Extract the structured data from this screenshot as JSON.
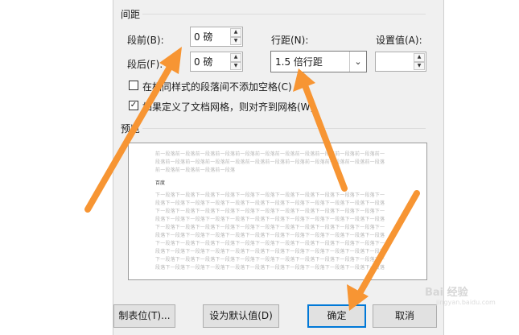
{
  "section": {
    "spacing_title": "间距",
    "preview_title": "预览"
  },
  "spacing": {
    "before_label": "段前(B):",
    "before_value": "0 磅",
    "after_label": "段后(F):",
    "after_value": "0 磅",
    "line_label": "行距(N):",
    "line_value": "1.5 倍行距",
    "setting_label": "设置值(A):",
    "setting_value": ""
  },
  "checkboxes": {
    "same_style_label": "在相同样式的段落间不添加空格(C)",
    "same_style_checked": false,
    "grid_label": "如果定义了文档网格，则对齐到网格(W)",
    "grid_checked": true
  },
  "preview": {
    "prev_lines": [
      "前一段落前一段落前一段落前一段落前一段落前一段落前一段落前一段落前一段落前一段落前一段落前一",
      "段落前一段落前一段落前一段落前一段落前一段落前一段落前一段落前一段落前一段落前一段落前一段落",
      "前一段落前一段落前一段落前一段落"
    ],
    "current_text": "百度",
    "next_lines": [
      "下一段落下一段落下一段落下一段落下一段落下一段落下一段落下一段落下一段落下一段落下一段落下一",
      "段落下一段落下一段落下一段落下一段落下一段落下一段落下一段落下一段落下一段落下一段落下一段落",
      "下一段落下一段落下一段落下一段落下一段落下一段落下一段落下一段落下一段落下一段落下一段落下一",
      "段落下一段落下一段落下一段落下一段落下一段落下一段落下一段落下一段落下一段落下一段落下一段落",
      "下一段落下一段落下一段落下一段落下一段落下一段落下一段落下一段落下一段落下一段落下一段落下一",
      "段落下一段落下一段落下一段落下一段落下一段落下一段落下一段落下一段落下一段落下一段落下一段落",
      "下一段落下一段落下一段落下一段落下一段落下一段落下一段落下一段落下一段落下一段落下一段落下一",
      "段落下一段落下一段落下一段落下一段落下一段落下一段落下一段落下一段落下一段落下一段落下一段落",
      "下一段落下一段落下一段落下一段落下一段落下一段落下一段落下一段落下一段落下一段落下一段落下一",
      "段落下一段落下一段落下一段落下一段落下一段落下一段落下一段落下一段落下一段落下一段落下一段落"
    ]
  },
  "buttons": {
    "tabs": "制表位(T)...",
    "default": "设为默认值(D)",
    "ok": "确定",
    "cancel": "取消"
  },
  "watermark": {
    "brand": "Bai 经验",
    "sub": "jingyan.baidu.com"
  },
  "colors": {
    "annotation_arrow": "#f79533",
    "focus_border": "#0078d7"
  }
}
